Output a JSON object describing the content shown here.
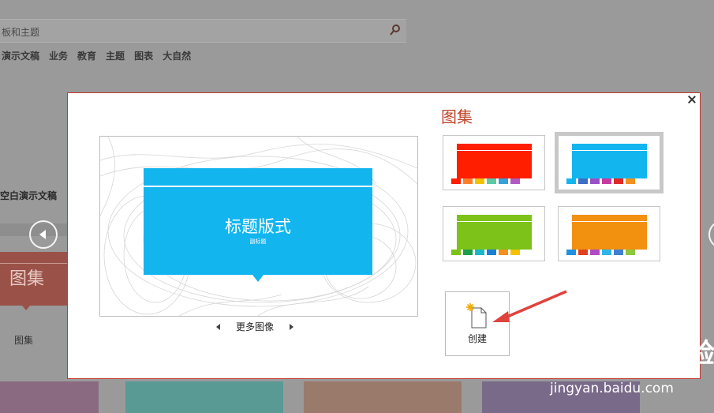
{
  "background": {
    "search": {
      "text": "板和主题"
    },
    "categories": [
      "演示文稿",
      "业务",
      "教育",
      "主题",
      "图表",
      "大自然"
    ],
    "blank_label": "空白演示文稿",
    "gallery_thumb_text": "图集",
    "gallery_label": "图集",
    "tiles": [
      {
        "color": "#8a6a80"
      },
      {
        "color": "#5a9a94"
      },
      {
        "color": "#9a7a6a"
      },
      {
        "color": "#7a6a8a"
      }
    ]
  },
  "dialog": {
    "preview": {
      "title": "标题版式",
      "subtitle": "副标题",
      "accent_color": "#13b5ef"
    },
    "more_images_label": "更多图像",
    "gallery_title": "图集",
    "variants": [
      {
        "name": "red",
        "color": "#ff1f00",
        "selected": false,
        "swatches": [
          "#ff1f00",
          "#ff7f27",
          "#f2c200",
          "#5cc9a7",
          "#3aa0d8",
          "#b25ac4"
        ]
      },
      {
        "name": "blue",
        "color": "#13b5ef",
        "selected": true,
        "swatches": [
          "#13b5ef",
          "#3c6fc3",
          "#9a50c4",
          "#c93aa0",
          "#e02828",
          "#f29020"
        ]
      },
      {
        "name": "green",
        "color": "#7cc218",
        "selected": false,
        "swatches": [
          "#7cc218",
          "#1e9e4a",
          "#1ab8c8",
          "#1b7fd6",
          "#f29020",
          "#f2c200"
        ]
      },
      {
        "name": "orange",
        "color": "#f29010",
        "selected": false,
        "swatches": [
          "#2090e0",
          "#e04020",
          "#b04cc4",
          "#2fb5e8",
          "#3f7fd0",
          "#8dc63f"
        ]
      }
    ],
    "create_label": "创建"
  },
  "watermark": {
    "main": "Bai du 经验",
    "sub": "jingyan.baidu.com"
  },
  "colors": {
    "dialog_border": "#c0392b",
    "gallery_title": "#c0452a",
    "arrow": "#e0423d"
  }
}
